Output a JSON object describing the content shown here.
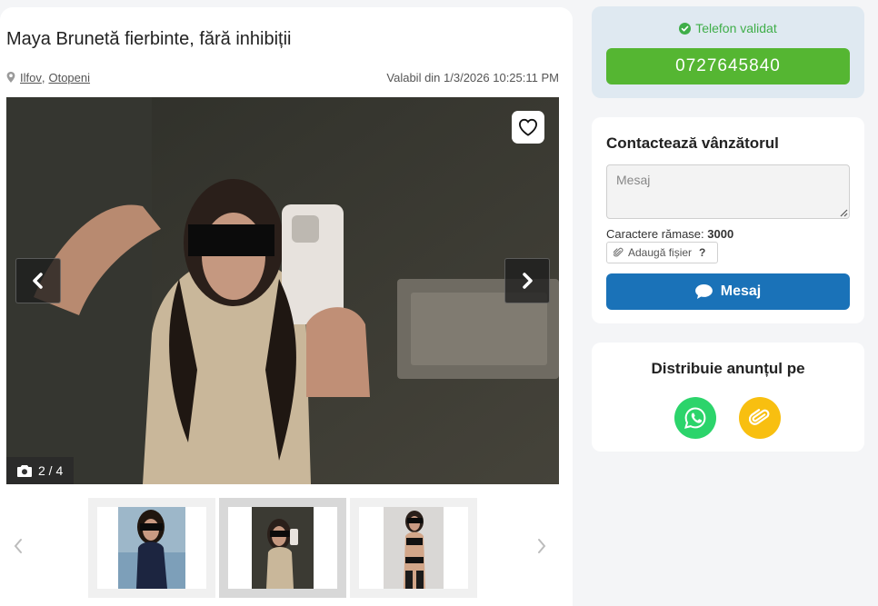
{
  "listing": {
    "title": "Maya Brunetă fierbinte, fără inhibiții",
    "location": {
      "county": "Ilfov",
      "city": "Otopeni"
    },
    "valid_since": "Valabil din 1/3/2026 10:25:11 PM"
  },
  "gallery": {
    "counter": "2 / 4",
    "current_index": 2,
    "total": 4,
    "thumbnails": [
      {
        "name": "photo-1",
        "active": false
      },
      {
        "name": "photo-2",
        "active": true
      },
      {
        "name": "photo-3",
        "active": false
      }
    ]
  },
  "phone": {
    "verified_label": "Telefon validat",
    "number": "0727645840"
  },
  "contact": {
    "title": "Contactează vânzătorul",
    "message_placeholder": "Mesaj",
    "chars_label": "Caractere rămase:",
    "chars_remaining": "3000",
    "attach_label": "Adaugă fișier",
    "attach_help": "?",
    "send_label": "Mesaj"
  },
  "share": {
    "title": "Distribuie anunțul pe",
    "buttons": [
      {
        "name": "whatsapp",
        "icon": "whatsapp-icon"
      },
      {
        "name": "copy-link",
        "icon": "paperclip-icon"
      }
    ]
  },
  "colors": {
    "phone_button": "#55b632",
    "verified": "#3fae49",
    "send_button": "#1a72b8",
    "whatsapp": "#2cd46b",
    "copy_link": "#f8bf10",
    "phone_card_bg": "#dfe9f1"
  }
}
